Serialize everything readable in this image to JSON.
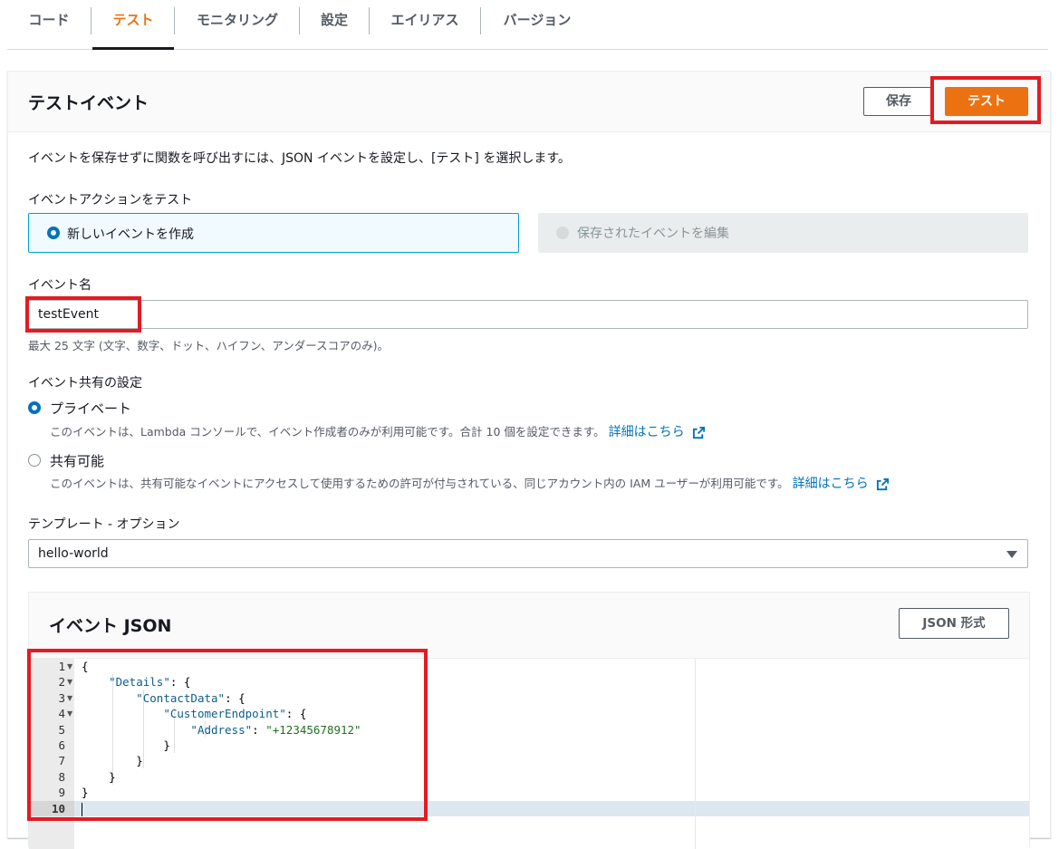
{
  "tabs": [
    {
      "label": "コード"
    },
    {
      "label": "テスト"
    },
    {
      "label": "モニタリング"
    },
    {
      "label": "設定"
    },
    {
      "label": "エイリアス"
    },
    {
      "label": "バージョン"
    }
  ],
  "panel": {
    "title": "テストイベント",
    "save_label": "保存",
    "test_label": "テスト",
    "description": "イベントを保存せずに関数を呼び出すには、JSON イベントを設定し、[テスト] を選択します。"
  },
  "event_action": {
    "label": "イベントアクションをテスト",
    "new_label": "新しいイベントを作成",
    "saved_label": "保存されたイベントを編集"
  },
  "event_name": {
    "label": "イベント名",
    "value": "testEvent",
    "hint": "最大 25 文字 (文字、数字、ドット、ハイフン、アンダースコアのみ)。"
  },
  "sharing": {
    "label": "イベント共有の設定",
    "private_label": "プライベート",
    "private_desc": "このイベントは、Lambda コンソールで、イベント作成者のみが利用可能です。合計 10 個を設定できます。",
    "shareable_label": "共有可能",
    "shareable_desc": "このイベントは、共有可能なイベントにアクセスして使用するための許可が付与されている、同じアカウント内の IAM ユーザーが利用可能です。",
    "learn_more": "詳細はこちら"
  },
  "template": {
    "label": "テンプレート - オプション",
    "value": "hello-world"
  },
  "json": {
    "title": "イベント JSON",
    "format_label": "JSON 形式",
    "line_numbers": [
      "1",
      "2",
      "3",
      "4",
      "5",
      "6",
      "7",
      "8",
      "9",
      "10"
    ],
    "lines": [
      {
        "indent": "",
        "key": "",
        "rest": "{"
      },
      {
        "indent": "    ",
        "key": "\"Details\"",
        "rest": ": {"
      },
      {
        "indent": "        ",
        "key": "\"ContactData\"",
        "rest": ": {"
      },
      {
        "indent": "            ",
        "key": "\"CustomerEndpoint\"",
        "rest": ": {"
      },
      {
        "indent": "                ",
        "key": "\"Address\"",
        "rest": ": ",
        "value": "\"+12345678912\""
      },
      {
        "indent": "            ",
        "key": "",
        "rest": "}"
      },
      {
        "indent": "        ",
        "key": "",
        "rest": "}"
      },
      {
        "indent": "    ",
        "key": "",
        "rest": "}"
      },
      {
        "indent": "",
        "key": "",
        "rest": "}"
      },
      {
        "indent": "",
        "key": "",
        "rest": ""
      }
    ]
  },
  "colors": {
    "accent": "#ec7211",
    "link": "#0073bb",
    "highlight_box": "#e31b23"
  }
}
